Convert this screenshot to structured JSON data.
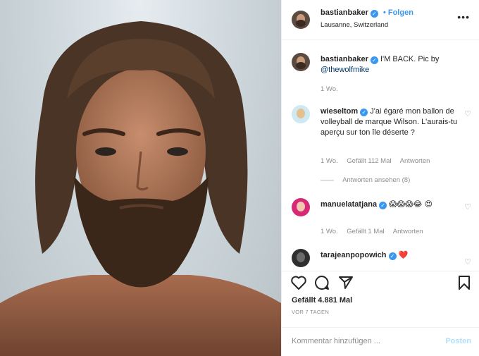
{
  "post": {
    "author": "bastianbaker",
    "follow_label": "Folgen",
    "location": "Lausanne, Switzerland",
    "caption_author": "bastianbaker",
    "caption_text": "I'M BACK. Pic by",
    "caption_mention": "@thewolfmike",
    "caption_age": "1 Wo."
  },
  "comments": [
    {
      "author": "wieseltom",
      "text": "J'ai égaré mon ballon de volleyball de marque Wilson. L'aurais-tu aperçu sur ton île déserte ?",
      "age": "1 Wo.",
      "likes": "Gefällt 112 Mal",
      "reply": "Antworten",
      "view_replies": "Antworten ansehen (8)"
    },
    {
      "author": "manuelatatjana",
      "text": "😱😱😱😂 😍",
      "age": "1 Wo.",
      "likes": "Gefällt 1 Mal",
      "reply": "Antworten"
    },
    {
      "author": "tarajeanpopowich",
      "text": "❤️"
    }
  ],
  "stats": {
    "likes": "Gefällt 4.881 Mal",
    "date": "VOR 7 TAGEN"
  },
  "composer": {
    "placeholder": "Kommentar hinzufügen ...",
    "post_label": "Posten"
  },
  "colors": {
    "accent": "#3897f0",
    "muted": "#8e8e8e",
    "heart_red": "#ed4956"
  }
}
